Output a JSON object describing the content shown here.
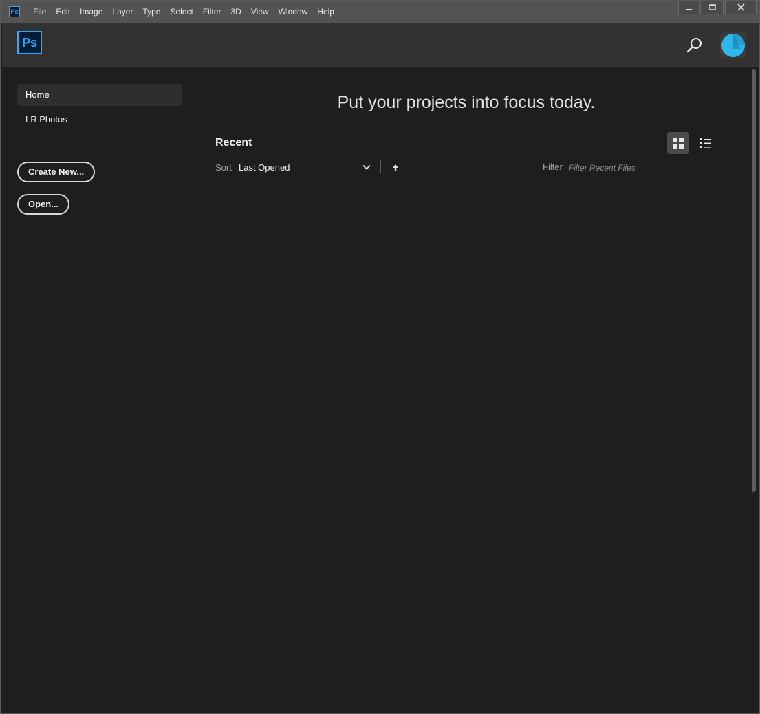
{
  "menubar": {
    "app_icon": "Ps",
    "items": [
      "File",
      "Edit",
      "Image",
      "Layer",
      "Type",
      "Select",
      "Filter",
      "3D",
      "View",
      "Window",
      "Help"
    ],
    "controls": {
      "minimize": "—",
      "maximize": "□",
      "close": "✕"
    }
  },
  "header": {
    "logo": "Ps",
    "search_icon": "search-icon",
    "avatar_icon": "creative-cloud-avatar",
    "accent_color": "#31a8ff"
  },
  "sidebar": {
    "nav": [
      {
        "label": "Home",
        "active": true
      },
      {
        "label": "LR Photos",
        "active": false
      }
    ],
    "create_label": "Create New...",
    "open_label": "Open..."
  },
  "main": {
    "headline": "Put your projects into focus today.",
    "recent_title": "Recent",
    "view_modes": [
      {
        "icon": "grid-view-icon",
        "active": true
      },
      {
        "icon": "list-view-icon",
        "active": false
      }
    ],
    "sort": {
      "label": "Sort",
      "value": "Last Opened",
      "direction_icon": "arrow-up-icon"
    },
    "filter": {
      "label": "Filter",
      "placeholder": "Filter Recent Files",
      "value": ""
    }
  }
}
